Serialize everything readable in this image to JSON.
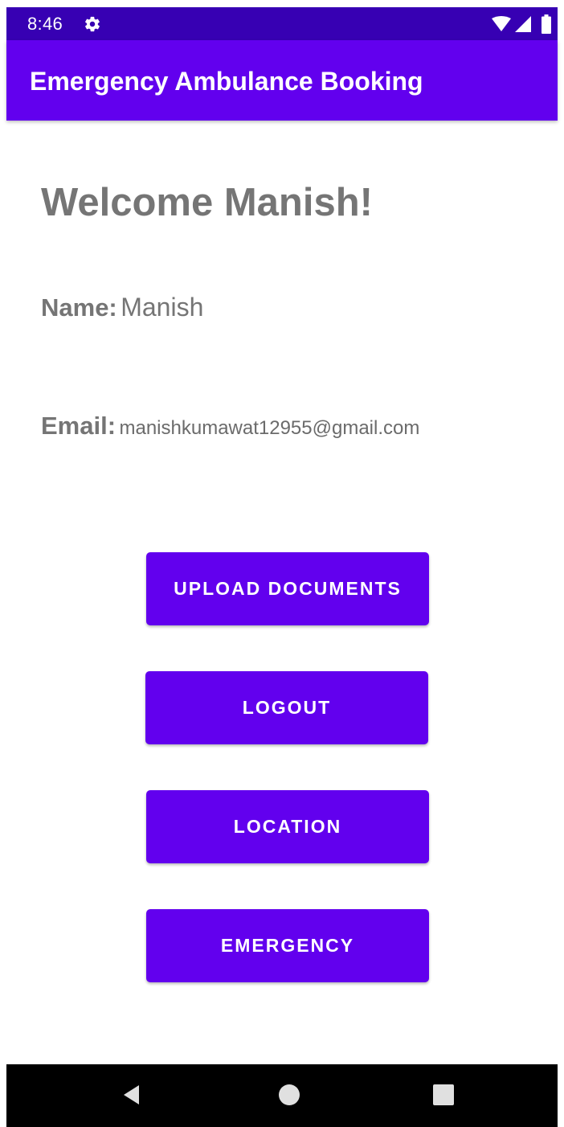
{
  "status_bar": {
    "time": "8:46",
    "icons": [
      "settings-gear-icon",
      "wifi-icon",
      "cell-signal-icon",
      "battery-icon"
    ],
    "background": "#3700B3"
  },
  "app_bar": {
    "title": "Emergency Ambulance Booking",
    "background": "#6200EE"
  },
  "profile": {
    "welcome": "Welcome Manish!",
    "name_label": "Name:",
    "name_value": "Manish",
    "email_label": "Email:",
    "email_value": "manishkumawat12955@gmail.com"
  },
  "actions": {
    "upload_label": "UPLOAD DOCUMENTS",
    "logout_label": "LOGOUT",
    "location_label": "LOCATION",
    "emergency_label": "EMERGENCY",
    "button_color": "#6200EE"
  },
  "nav_bar": {
    "icons": [
      "back-icon",
      "home-icon",
      "recents-icon"
    ]
  }
}
